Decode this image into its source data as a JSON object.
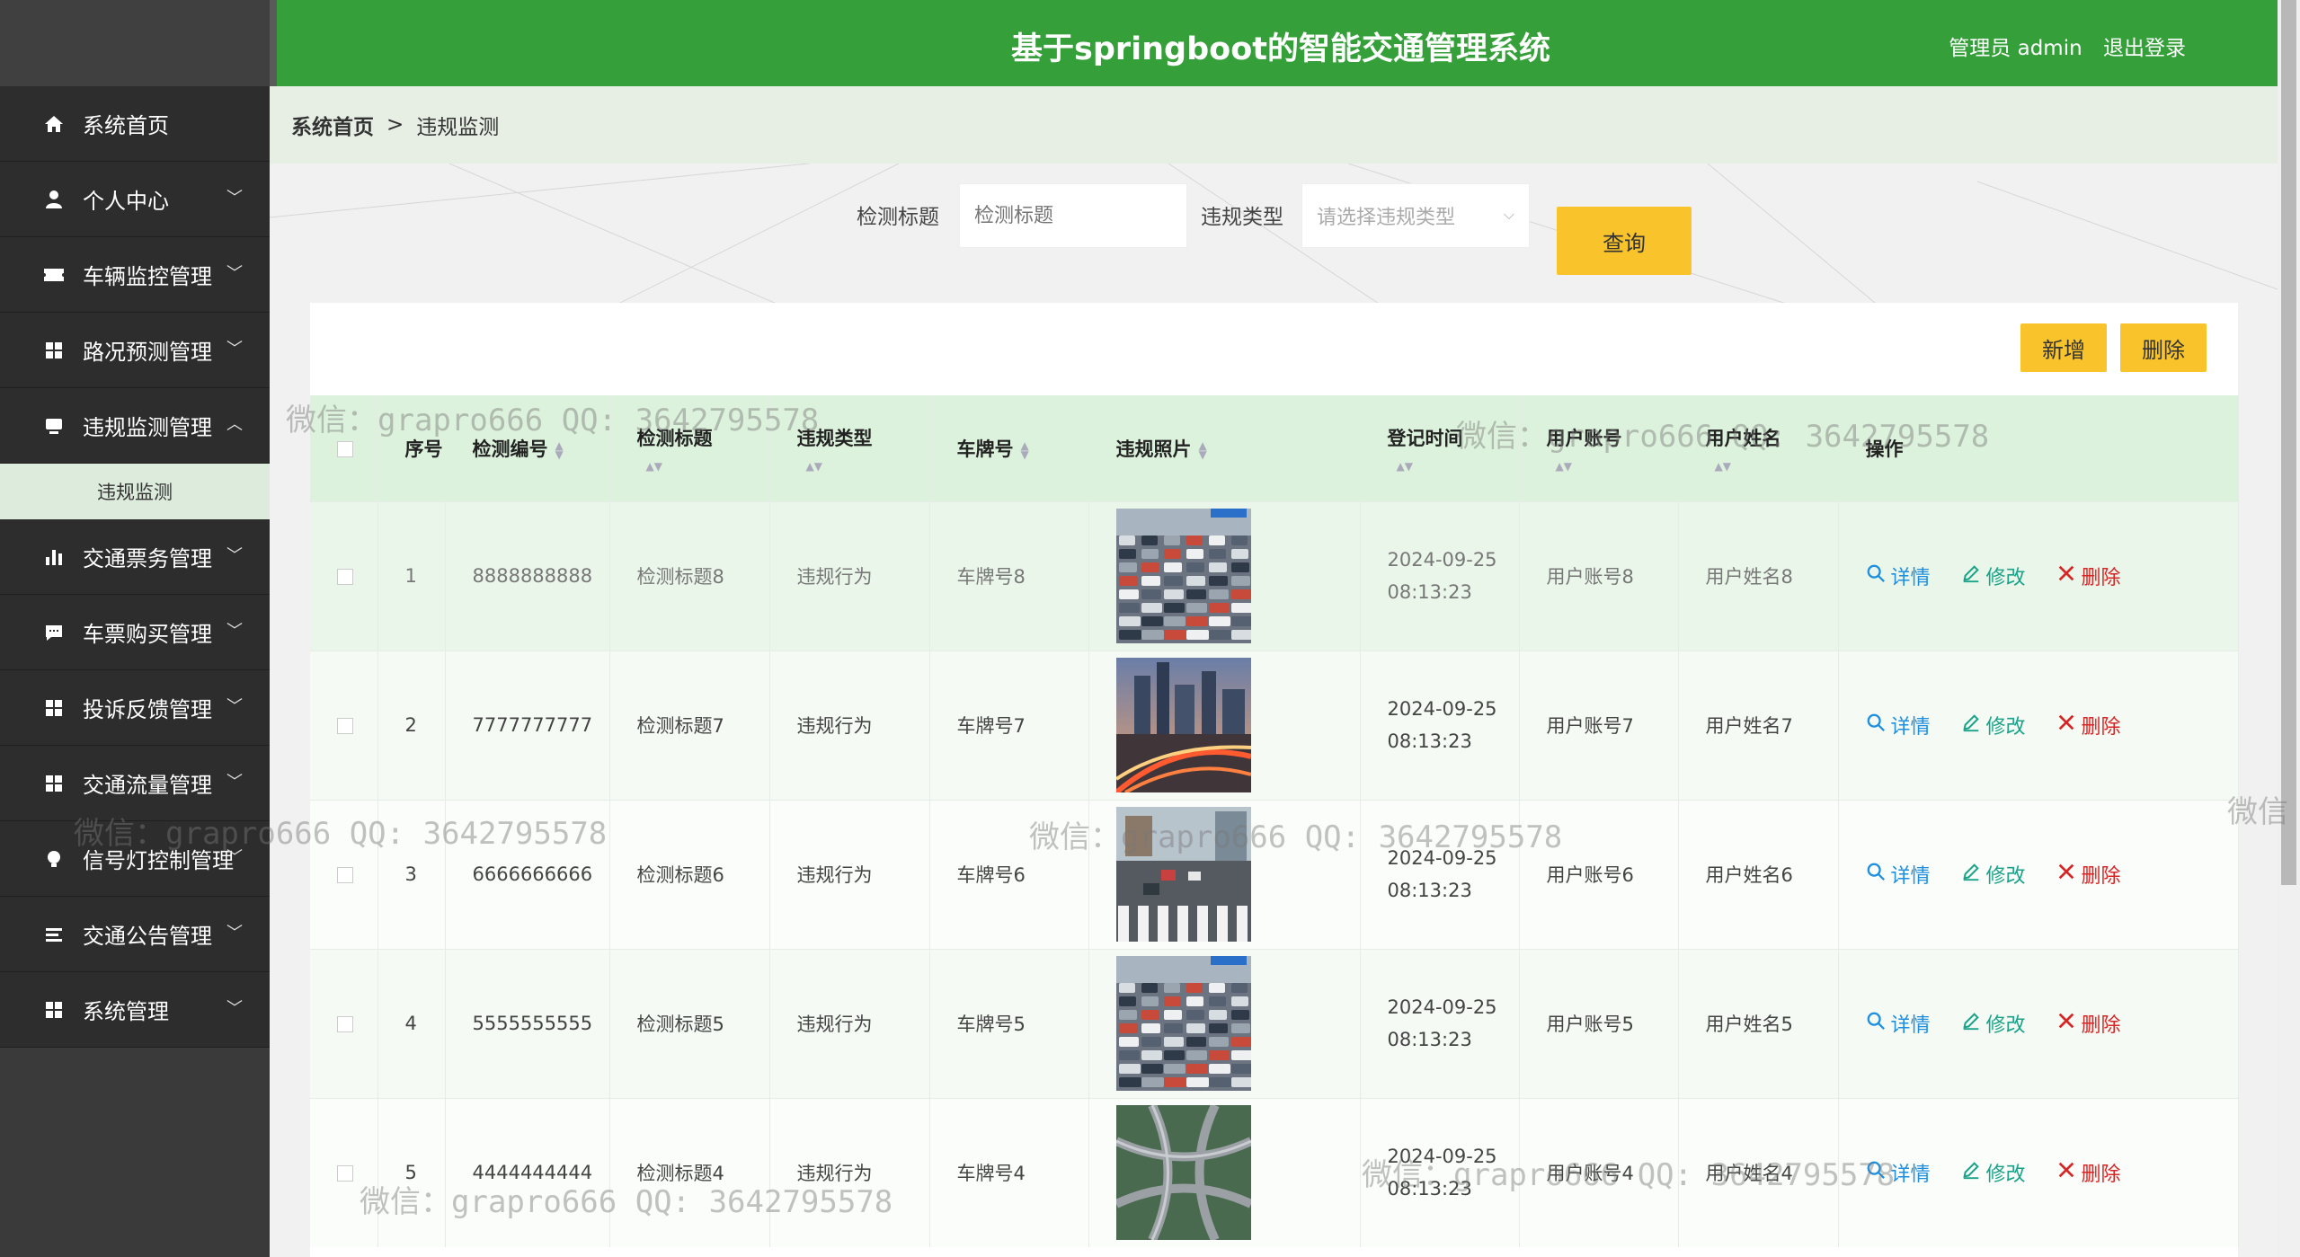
{
  "header": {
    "title": "基于springboot的智能交通管理系统",
    "user_label": "管理员 admin",
    "logout_label": "退出登录"
  },
  "sidebar": {
    "items": [
      {
        "label": "系统首页",
        "icon": "home-icon",
        "expandable": false
      },
      {
        "label": "个人中心",
        "icon": "user-icon",
        "expandable": true
      },
      {
        "label": "车辆监控管理",
        "icon": "ticket-icon",
        "expandable": true
      },
      {
        "label": "路况预测管理",
        "icon": "grid-icon",
        "expandable": true
      },
      {
        "label": "违规监测管理",
        "icon": "monitor-icon",
        "expandable": true,
        "expanded": true
      },
      {
        "label": "交通票务管理",
        "icon": "bar-chart-icon",
        "expandable": true
      },
      {
        "label": "车票购买管理",
        "icon": "message-icon",
        "expandable": true
      },
      {
        "label": "投诉反馈管理",
        "icon": "grid-icon",
        "expandable": true
      },
      {
        "label": "交通流量管理",
        "icon": "grid-icon",
        "expandable": true
      },
      {
        "label": "信号灯控制管理",
        "icon": "bulb-icon",
        "expandable": true
      },
      {
        "label": "交通公告管理",
        "icon": "list-icon",
        "expandable": true
      },
      {
        "label": "系统管理",
        "icon": "grid-icon",
        "expandable": true
      }
    ],
    "submenu_active": "违规监测"
  },
  "breadcrumb": {
    "home": "系统首页",
    "separator": ">",
    "current": "违规监测"
  },
  "search": {
    "title_label": "检测标题",
    "title_placeholder": "检测标题",
    "type_label": "违规类型",
    "type_placeholder": "请选择违规类型",
    "query_label": "查询"
  },
  "toolbar": {
    "add_label": "新增",
    "delete_label": "删除"
  },
  "table": {
    "headers": [
      "序号",
      "检测编号",
      "检测标题",
      "违规类型",
      "车牌号",
      "违规照片",
      "登记时间",
      "用户账号",
      "用户姓名",
      "操作"
    ],
    "rows": [
      {
        "index": "1",
        "code": "8888888888",
        "title": "检测标题8",
        "type": "违规行为",
        "plate": "车牌号8",
        "photo": "traffic-jam",
        "date": "2024-09-25",
        "time": "08:13:23",
        "account": "用户账号8",
        "name": "用户姓名8"
      },
      {
        "index": "2",
        "code": "7777777777",
        "title": "检测标题7",
        "type": "违规行为",
        "plate": "车牌号7",
        "photo": "city-night",
        "date": "2024-09-25",
        "time": "08:13:23",
        "account": "用户账号7",
        "name": "用户姓名7"
      },
      {
        "index": "3",
        "code": "6666666666",
        "title": "检测标题6",
        "type": "违规行为",
        "plate": "车牌号6",
        "photo": "crosswalk",
        "date": "2024-09-25",
        "time": "08:13:23",
        "account": "用户账号6",
        "name": "用户姓名6"
      },
      {
        "index": "4",
        "code": "5555555555",
        "title": "检测标题5",
        "type": "违规行为",
        "plate": "车牌号5",
        "photo": "traffic-jam",
        "date": "2024-09-25",
        "time": "08:13:23",
        "account": "用户账号5",
        "name": "用户姓名5"
      },
      {
        "index": "5",
        "code": "4444444444",
        "title": "检测标题4",
        "type": "违规行为",
        "plate": "车牌号4",
        "photo": "interchange",
        "date": "2024-09-25",
        "time": "08:13:23",
        "account": "用户账号4",
        "name": "用户姓名4"
      }
    ],
    "actions": {
      "detail": "详情",
      "edit": "修改",
      "delete": "删除"
    }
  },
  "watermark_text": "微信：grapro666 QQ: 3642795578",
  "watermark_partial": "微信",
  "colors": {
    "header_green": "#35a03a",
    "button_yellow": "#f8c32b",
    "sidebar_dark": "#2d2d2d",
    "detail_blue": "#1e8fe0",
    "edit_teal": "#1aa388",
    "delete_red": "#d62525"
  }
}
